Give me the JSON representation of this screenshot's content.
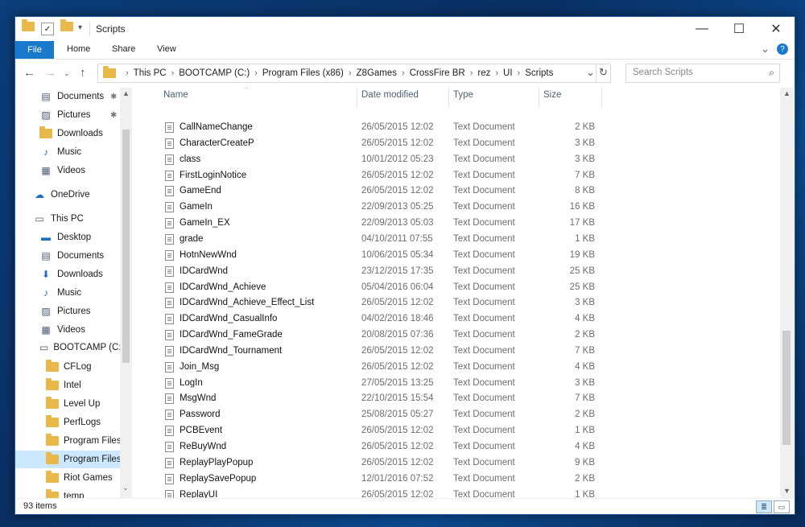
{
  "window": {
    "title": "Scripts",
    "controls": {
      "minimize": "—",
      "maximize": "☐",
      "close": "✕"
    }
  },
  "ribbon": {
    "file": "File",
    "tabs": [
      "Home",
      "Share",
      "View"
    ],
    "expand": "⌄",
    "help": "?"
  },
  "address": {
    "crumbs": [
      "This PC",
      "BOOTCAMP (C:)",
      "Program Files (x86)",
      "Z8Games",
      "CrossFire BR",
      "rez",
      "UI",
      "Scripts"
    ],
    "refresh": "↻",
    "dropdown": "⌄"
  },
  "search": {
    "placeholder": "Search Scripts"
  },
  "nav": {
    "items": [
      {
        "label": "Documents",
        "icon": "documents-icon",
        "pinned": true
      },
      {
        "label": "Pictures",
        "icon": "pictures-icon",
        "pinned": true
      },
      {
        "label": "Downloads",
        "icon": "folder-icon"
      },
      {
        "label": "Music",
        "icon": "music-icon"
      },
      {
        "label": "Videos",
        "icon": "videos-icon"
      },
      {
        "label": "OneDrive",
        "icon": "onedrive-icon"
      },
      {
        "label": "This PC",
        "icon": "pc-icon"
      },
      {
        "label": "Desktop",
        "icon": "desktop-icon"
      },
      {
        "label": "Documents",
        "icon": "documents-icon"
      },
      {
        "label": "Downloads",
        "icon": "download-icon"
      },
      {
        "label": "Music",
        "icon": "music-icon"
      },
      {
        "label": "Pictures",
        "icon": "pictures-icon"
      },
      {
        "label": "Videos",
        "icon": "videos-icon"
      },
      {
        "label": "BOOTCAMP (C:)",
        "icon": "drive-icon"
      },
      {
        "label": "CFLog",
        "icon": "folder-icon"
      },
      {
        "label": "Intel",
        "icon": "folder-icon"
      },
      {
        "label": "Level Up",
        "icon": "folder-icon"
      },
      {
        "label": "PerfLogs",
        "icon": "folder-icon"
      },
      {
        "label": "Program Files",
        "icon": "folder-icon"
      },
      {
        "label": "Program Files (",
        "icon": "folder-icon",
        "selected": true
      },
      {
        "label": "Riot Games",
        "icon": "folder-icon"
      },
      {
        "label": "temp",
        "icon": "folder-icon"
      }
    ]
  },
  "columns": {
    "name": "Name",
    "date": "Date modified",
    "type": "Type",
    "size": "Size"
  },
  "files": [
    {
      "name": "CallNameChange",
      "date": "26/05/2015 12:02",
      "type": "Text Document",
      "size": "2 KB"
    },
    {
      "name": "CharacterCreateP",
      "date": "26/05/2015 12:02",
      "type": "Text Document",
      "size": "3 KB"
    },
    {
      "name": "class",
      "date": "10/01/2012 05:23",
      "type": "Text Document",
      "size": "3 KB"
    },
    {
      "name": "FirstLoginNotice",
      "date": "26/05/2015 12:02",
      "type": "Text Document",
      "size": "7 KB"
    },
    {
      "name": "GameEnd",
      "date": "26/05/2015 12:02",
      "type": "Text Document",
      "size": "8 KB"
    },
    {
      "name": "GameIn",
      "date": "22/09/2013 05:25",
      "type": "Text Document",
      "size": "16 KB"
    },
    {
      "name": "GameIn_EX",
      "date": "22/09/2013 05:03",
      "type": "Text Document",
      "size": "17 KB"
    },
    {
      "name": "grade",
      "date": "04/10/2011 07:55",
      "type": "Text Document",
      "size": "1 KB"
    },
    {
      "name": "HotnNewWnd",
      "date": "10/06/2015 05:34",
      "type": "Text Document",
      "size": "19 KB"
    },
    {
      "name": "IDCardWnd",
      "date": "23/12/2015 17:35",
      "type": "Text Document",
      "size": "25 KB"
    },
    {
      "name": "IDCardWnd_Achieve",
      "date": "05/04/2016 06:04",
      "type": "Text Document",
      "size": "25 KB"
    },
    {
      "name": "IDCardWnd_Achieve_Effect_List",
      "date": "26/05/2015 12:02",
      "type": "Text Document",
      "size": "3 KB"
    },
    {
      "name": "IDCardWnd_CasualInfo",
      "date": "04/02/2016 18:46",
      "type": "Text Document",
      "size": "4 KB"
    },
    {
      "name": "IDCardWnd_FameGrade",
      "date": "20/08/2015 07:36",
      "type": "Text Document",
      "size": "2 KB"
    },
    {
      "name": "IDCardWnd_Tournament",
      "date": "26/05/2015 12:02",
      "type": "Text Document",
      "size": "7 KB"
    },
    {
      "name": "Join_Msg",
      "date": "26/05/2015 12:02",
      "type": "Text Document",
      "size": "4 KB"
    },
    {
      "name": "LogIn",
      "date": "27/05/2015 13:25",
      "type": "Text Document",
      "size": "3 KB"
    },
    {
      "name": "MsgWnd",
      "date": "22/10/2015 15:54",
      "type": "Text Document",
      "size": "7 KB"
    },
    {
      "name": "Password",
      "date": "25/08/2015 05:27",
      "type": "Text Document",
      "size": "2 KB"
    },
    {
      "name": "PCBEvent",
      "date": "26/05/2015 12:02",
      "type": "Text Document",
      "size": "1 KB"
    },
    {
      "name": "ReBuyWnd",
      "date": "26/05/2015 12:02",
      "type": "Text Document",
      "size": "4 KB"
    },
    {
      "name": "ReplayPlayPopup",
      "date": "26/05/2015 12:02",
      "type": "Text Document",
      "size": "9 KB"
    },
    {
      "name": "ReplaySavePopup",
      "date": "12/01/2016 07:52",
      "type": "Text Document",
      "size": "2 KB"
    },
    {
      "name": "ReplayUI",
      "date": "26/05/2015 12:02",
      "type": "Text Document",
      "size": "1 KB"
    }
  ],
  "status": {
    "count": "93 items"
  }
}
